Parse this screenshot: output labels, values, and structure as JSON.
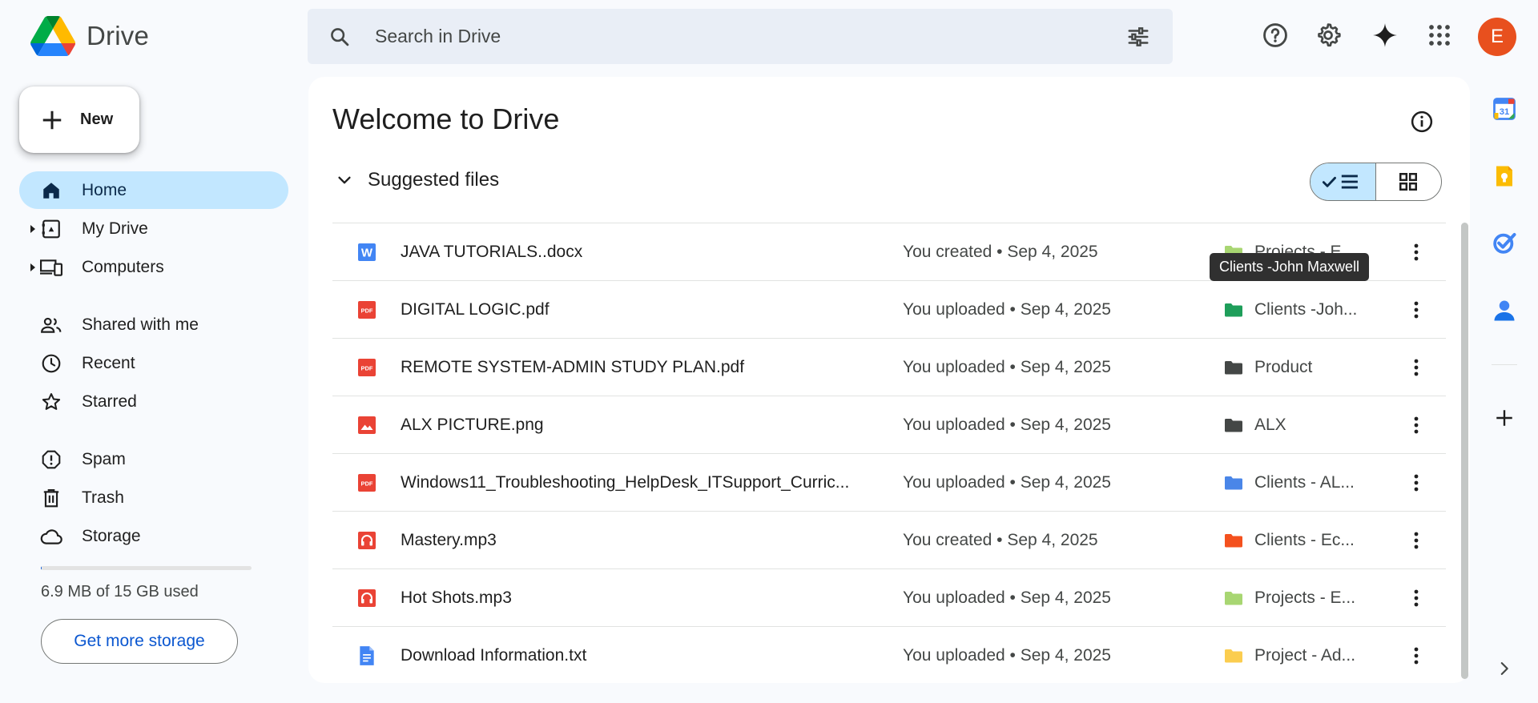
{
  "app": {
    "name": "Drive"
  },
  "search": {
    "placeholder": "Search in Drive"
  },
  "header_icons": [
    "help-icon",
    "settings-icon",
    "gemini-icon",
    "apps-icon"
  ],
  "account": {
    "initial": "E",
    "color": "#e8501e"
  },
  "sidebar": {
    "new_label": "New",
    "items": [
      {
        "label": "Home",
        "icon": "home-icon",
        "active": true
      },
      {
        "label": "My Drive",
        "icon": "my-drive-icon",
        "expandable": true
      },
      {
        "label": "Computers",
        "icon": "computers-icon",
        "expandable": true
      },
      {
        "label": "Shared with me",
        "icon": "shared-icon"
      },
      {
        "label": "Recent",
        "icon": "clock-icon"
      },
      {
        "label": "Starred",
        "icon": "star-icon"
      },
      {
        "label": "Spam",
        "icon": "spam-icon"
      },
      {
        "label": "Trash",
        "icon": "trash-icon"
      },
      {
        "label": "Storage",
        "icon": "cloud-icon"
      }
    ],
    "storage": {
      "used_text": "6.9 MB of 15 GB used",
      "used_fraction": 0.0005,
      "button_label": "Get more storage"
    }
  },
  "main": {
    "title": "Welcome to Drive",
    "section_title": "Suggested files",
    "view_mode": "list",
    "files": [
      {
        "name": "JAVA TUTORIALS..docx",
        "type": "word",
        "activity": "You created • Sep 4, 2025",
        "location": "Projects - E...",
        "folder_color": "#a8d672"
      },
      {
        "name": "DIGITAL LOGIC.pdf",
        "type": "pdf",
        "activity": "You uploaded • Sep 4, 2025",
        "location": "Clients -Joh...",
        "folder_color": "#1e9e5a"
      },
      {
        "name": "REMOTE SYSTEM-ADMIN STUDY PLAN.pdf",
        "type": "pdf",
        "activity": "You uploaded • Sep 4, 2025",
        "location": "Product",
        "folder_color": "#444746"
      },
      {
        "name": "ALX PICTURE.png",
        "type": "image",
        "activity": "You uploaded • Sep 4, 2025",
        "location": "ALX",
        "folder_color": "#444746"
      },
      {
        "name": "Windows11_Troubleshooting_HelpDesk_ITSupport_Curric...",
        "type": "pdf",
        "activity": "You uploaded • Sep 4, 2025",
        "location": "Clients - AL...",
        "folder_color": "#4a86e8"
      },
      {
        "name": "Mastery.mp3",
        "type": "audio",
        "activity": "You created • Sep 4, 2025",
        "location": "Clients - Ec...",
        "folder_color": "#f4511e"
      },
      {
        "name": "Hot Shots.mp3",
        "type": "audio",
        "activity": "You uploaded • Sep 4, 2025",
        "location": "Projects - E...",
        "folder_color": "#a8d672"
      },
      {
        "name": "Download Information.txt",
        "type": "doc",
        "activity": "You uploaded • Sep 4, 2025",
        "location": "Project - Ad...",
        "folder_color": "#fbcd4f"
      }
    ]
  },
  "tooltip": {
    "text": "Clients -John Maxwell"
  },
  "side_panel": {
    "apps": [
      "calendar-icon",
      "keep-icon",
      "tasks-icon",
      "contacts-icon"
    ],
    "calendar_day": "31",
    "add_label": "add-addon-icon"
  }
}
